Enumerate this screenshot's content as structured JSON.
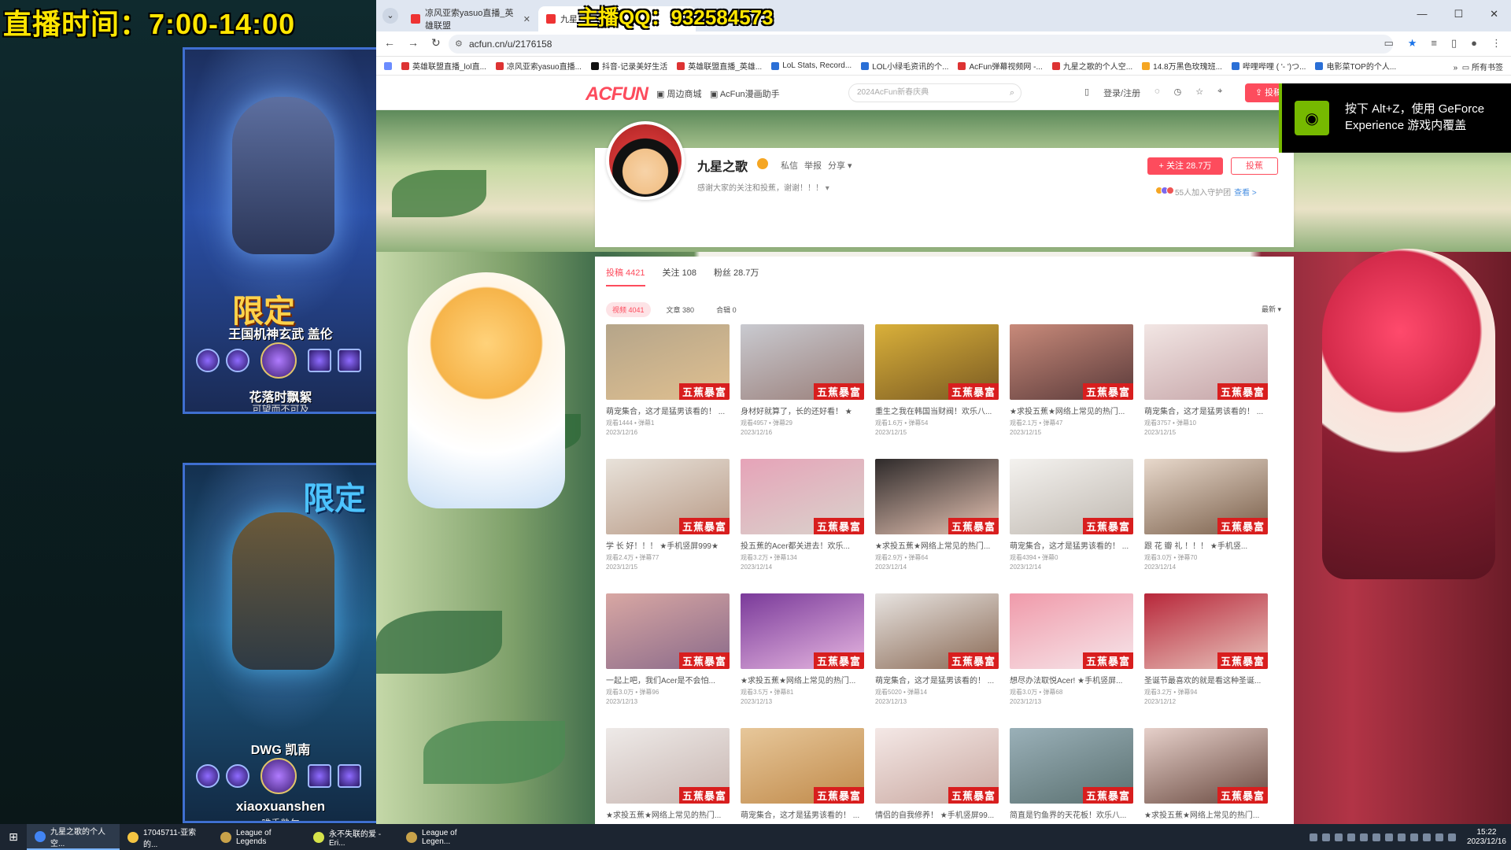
{
  "overlay": {
    "stream_time": "直播时间：7:00-14:00",
    "qq": "主播QQ：932584573"
  },
  "left_cards": [
    {
      "badge": "限定",
      "champion": "王国机神玄武 盖伦",
      "player": "花落时飘絮",
      "player_sub": "可望而不可及"
    },
    {
      "badge": "限定",
      "champion": "DWG 凯南",
      "player": "xiaoxuanshen",
      "player_sub": "唯手熟尔"
    }
  ],
  "browser": {
    "tabs": [
      {
        "label": "凉风亚索yasuo直播_英雄联盟"
      },
      {
        "label": "九星"
      }
    ],
    "url": "acfun.cn/u/2176158",
    "bookmarks": [
      "英雄联盟直播_lol直...",
      "凉风亚索yasuo直播...",
      "抖音-记录美好生活",
      "英雄联盟直播_英雄...",
      "LoL Stats, Record...",
      "LOL小绿毛资讯的个...",
      "AcFun弹幕视频网 -...",
      "九星之歌的个人空...",
      "14.8万黑色玫瑰班...",
      "哔哩哔哩 ( '- ')つ...",
      "电影菜TOP的个人..."
    ],
    "bookmarks_all": "所有书签"
  },
  "acfun": {
    "logo": "ACFUN",
    "nav_links": [
      "周边商城",
      "AcFun漫画助手"
    ],
    "search_placeholder": "2024AcFun新春庆典",
    "login": "登录/注册",
    "upload": "投稿"
  },
  "profile": {
    "name": "九星之歌",
    "links": [
      "私信",
      "举报",
      "分享 ▾"
    ],
    "bio": "感谢大家的关注和投蕉，谢谢！！！",
    "follow": "+ 关注 28.7万",
    "gift": "投蕉",
    "guard": "55人加入守护团",
    "guard_view": "查看 >"
  },
  "main_tabs": [
    "投稿 4421",
    "关注 108",
    "粉丝 28.7万"
  ],
  "sub_tabs": [
    "视频 4041",
    "文章 380",
    "合辑 0"
  ],
  "sort": "最新 ▾",
  "watermark": "五蕉暴富",
  "videos": [
    {
      "title": "萌宠集合，这才是猛男该看的！ ...",
      "meta": "观看1444 • 弹幕1",
      "date": "2023/12/16",
      "c1": "#b5a58a",
      "c2": "#e0c090"
    },
    {
      "title": "身材好就算了，长的还好看！ ★",
      "meta": "观看4957 • 弹幕29",
      "date": "2023/12/16",
      "c1": "#c9cad0",
      "c2": "#9a7f7a"
    },
    {
      "title": "重生之我在韩国当财阀！欢乐八...",
      "meta": "观看1.6万 • 弹幕54",
      "date": "2023/12/15",
      "c1": "#d9b03a",
      "c2": "#7a5a22"
    },
    {
      "title": "★求投五蕉★网络上常见的热门...",
      "meta": "观看2.1万 • 弹幕47",
      "date": "2023/12/15",
      "c1": "#c88a7a",
      "c2": "#5a3a3a"
    },
    {
      "title": "萌宠集合，这才是猛男该看的！ ...",
      "meta": "观看3757 • 弹幕10",
      "date": "2023/12/15",
      "c1": "#f2e6e4",
      "c2": "#c4a3a6"
    },
    {
      "title": "学 长 好！！！ ★手机竖屏999★",
      "meta": "观看2.4万 • 弹幕77",
      "date": "2023/12/15",
      "c1": "#e8e2da",
      "c2": "#b89a86"
    },
    {
      "title": "投五蕉的Acer都关进去！欢乐...",
      "meta": "观看3.2万 • 弹幕134",
      "date": "2023/12/14",
      "c1": "#e6a3b8",
      "c2": "#d9d3cc"
    },
    {
      "title": "★求投五蕉★网络上常见的热门...",
      "meta": "观看2.9万 • 弹幕64",
      "date": "2023/12/14",
      "c1": "#2e2a2a",
      "c2": "#e7c4b4"
    },
    {
      "title": "萌宠集合，这才是猛男该看的！ ...",
      "meta": "观看4394 • 弹幕0",
      "date": "2023/12/14",
      "c1": "#f4f2ef",
      "c2": "#bfb8b0"
    },
    {
      "title": "跟 花 瓣 礼 ！！！ ★手机竖...",
      "meta": "观看3.0万 • 弹幕70",
      "date": "2023/12/14",
      "c1": "#e8d9cc",
      "c2": "#7a5f4a"
    },
    {
      "title": "一起上吧，我们Acer是不会怕...",
      "meta": "观看3.0万 • 弹幕96",
      "date": "2023/12/13",
      "c1": "#d8a7a3",
      "c2": "#8a6a8a"
    },
    {
      "title": "★求投五蕉★网络上常见的热门...",
      "meta": "观看3.5万 • 弹幕81",
      "date": "2023/12/13",
      "c1": "#7a3a9a",
      "c2": "#e6b6e0"
    },
    {
      "title": "萌宠集合，这才是猛男该看的！ ...",
      "meta": "观看5020 • 弹幕14",
      "date": "2023/12/13",
      "c1": "#e7e3e0",
      "c2": "#8a6a55"
    },
    {
      "title": "想尽办法取悦Acer! ★手机竖屏...",
      "meta": "观看3.0万 • 弹幕68",
      "date": "2023/12/13",
      "c1": "#f09aaa",
      "c2": "#f6e6ea"
    },
    {
      "title": "圣诞节最喜欢的就是看这种圣诞...",
      "meta": "观看3.2万 • 弹幕94",
      "date": "2023/12/12",
      "c1": "#b8273a",
      "c2": "#e8c4bc"
    },
    {
      "title": "★求投五蕉★网络上常见的热门...",
      "meta": "",
      "date": "",
      "c1": "#eeeae8",
      "c2": "#c7b5b0"
    },
    {
      "title": "萌宠集合，这才是猛男该看的！ ...",
      "meta": "",
      "date": "",
      "c1": "#e7c79a",
      "c2": "#c08a4a"
    },
    {
      "title": "情侣的自我修养！ ★手机竖屏99...",
      "meta": "",
      "date": "",
      "c1": "#f4e8e6",
      "c2": "#c9a8a0"
    },
    {
      "title": "简直是钓鱼界的天花板！欢乐八...",
      "meta": "",
      "date": "",
      "c1": "#9ab0b8",
      "c2": "#5a7070"
    },
    {
      "title": "★求投五蕉★网络上常见的热门...",
      "meta": "",
      "date": "",
      "c1": "#e6d0ca",
      "c2": "#6a4a40"
    }
  ],
  "nvidia": {
    "text": "按下 Alt+Z，使用 GeForce Experience 游戏内覆盖"
  },
  "taskbar": {
    "items": [
      "九星之歌的个人空...",
      "17045711-亚索的...",
      "League of Legends",
      "永不失联的爱 - Eri...",
      "League of Legen..."
    ],
    "time": "15:22",
    "date": "2023/12/16"
  }
}
